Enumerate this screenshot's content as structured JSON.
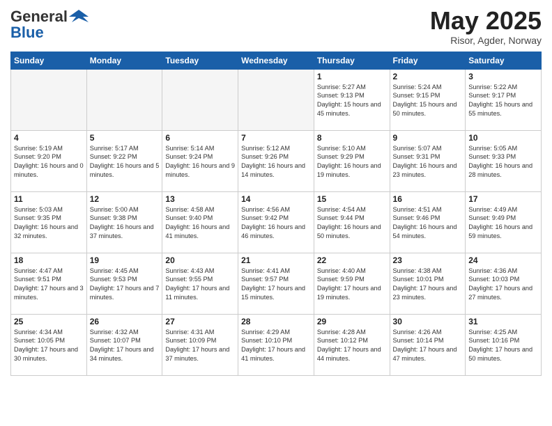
{
  "header": {
    "logo_general": "General",
    "logo_blue": "Blue",
    "month": "May 2025",
    "location": "Risor, Agder, Norway"
  },
  "days_of_week": [
    "Sunday",
    "Monday",
    "Tuesday",
    "Wednesday",
    "Thursday",
    "Friday",
    "Saturday"
  ],
  "weeks": [
    [
      {
        "day": "",
        "empty": true
      },
      {
        "day": "",
        "empty": true
      },
      {
        "day": "",
        "empty": true
      },
      {
        "day": "",
        "empty": true
      },
      {
        "day": "1",
        "sunrise": "5:27 AM",
        "sunset": "9:13 PM",
        "daylight": "15 hours and 45 minutes."
      },
      {
        "day": "2",
        "sunrise": "5:24 AM",
        "sunset": "9:15 PM",
        "daylight": "15 hours and 50 minutes."
      },
      {
        "day": "3",
        "sunrise": "5:22 AM",
        "sunset": "9:17 PM",
        "daylight": "15 hours and 55 minutes."
      }
    ],
    [
      {
        "day": "4",
        "sunrise": "5:19 AM",
        "sunset": "9:20 PM",
        "daylight": "16 hours and 0 minutes."
      },
      {
        "day": "5",
        "sunrise": "5:17 AM",
        "sunset": "9:22 PM",
        "daylight": "16 hours and 5 minutes."
      },
      {
        "day": "6",
        "sunrise": "5:14 AM",
        "sunset": "9:24 PM",
        "daylight": "16 hours and 9 minutes."
      },
      {
        "day": "7",
        "sunrise": "5:12 AM",
        "sunset": "9:26 PM",
        "daylight": "16 hours and 14 minutes."
      },
      {
        "day": "8",
        "sunrise": "5:10 AM",
        "sunset": "9:29 PM",
        "daylight": "16 hours and 19 minutes."
      },
      {
        "day": "9",
        "sunrise": "5:07 AM",
        "sunset": "9:31 PM",
        "daylight": "16 hours and 23 minutes."
      },
      {
        "day": "10",
        "sunrise": "5:05 AM",
        "sunset": "9:33 PM",
        "daylight": "16 hours and 28 minutes."
      }
    ],
    [
      {
        "day": "11",
        "sunrise": "5:03 AM",
        "sunset": "9:35 PM",
        "daylight": "16 hours and 32 minutes."
      },
      {
        "day": "12",
        "sunrise": "5:00 AM",
        "sunset": "9:38 PM",
        "daylight": "16 hours and 37 minutes."
      },
      {
        "day": "13",
        "sunrise": "4:58 AM",
        "sunset": "9:40 PM",
        "daylight": "16 hours and 41 minutes."
      },
      {
        "day": "14",
        "sunrise": "4:56 AM",
        "sunset": "9:42 PM",
        "daylight": "16 hours and 46 minutes."
      },
      {
        "day": "15",
        "sunrise": "4:54 AM",
        "sunset": "9:44 PM",
        "daylight": "16 hours and 50 minutes."
      },
      {
        "day": "16",
        "sunrise": "4:51 AM",
        "sunset": "9:46 PM",
        "daylight": "16 hours and 54 minutes."
      },
      {
        "day": "17",
        "sunrise": "4:49 AM",
        "sunset": "9:49 PM",
        "daylight": "16 hours and 59 minutes."
      }
    ],
    [
      {
        "day": "18",
        "sunrise": "4:47 AM",
        "sunset": "9:51 PM",
        "daylight": "17 hours and 3 minutes."
      },
      {
        "day": "19",
        "sunrise": "4:45 AM",
        "sunset": "9:53 PM",
        "daylight": "17 hours and 7 minutes."
      },
      {
        "day": "20",
        "sunrise": "4:43 AM",
        "sunset": "9:55 PM",
        "daylight": "17 hours and 11 minutes."
      },
      {
        "day": "21",
        "sunrise": "4:41 AM",
        "sunset": "9:57 PM",
        "daylight": "17 hours and 15 minutes."
      },
      {
        "day": "22",
        "sunrise": "4:40 AM",
        "sunset": "9:59 PM",
        "daylight": "17 hours and 19 minutes."
      },
      {
        "day": "23",
        "sunrise": "4:38 AM",
        "sunset": "10:01 PM",
        "daylight": "17 hours and 23 minutes."
      },
      {
        "day": "24",
        "sunrise": "4:36 AM",
        "sunset": "10:03 PM",
        "daylight": "17 hours and 27 minutes."
      }
    ],
    [
      {
        "day": "25",
        "sunrise": "4:34 AM",
        "sunset": "10:05 PM",
        "daylight": "17 hours and 30 minutes."
      },
      {
        "day": "26",
        "sunrise": "4:32 AM",
        "sunset": "10:07 PM",
        "daylight": "17 hours and 34 minutes."
      },
      {
        "day": "27",
        "sunrise": "4:31 AM",
        "sunset": "10:09 PM",
        "daylight": "17 hours and 37 minutes."
      },
      {
        "day": "28",
        "sunrise": "4:29 AM",
        "sunset": "10:10 PM",
        "daylight": "17 hours and 41 minutes."
      },
      {
        "day": "29",
        "sunrise": "4:28 AM",
        "sunset": "10:12 PM",
        "daylight": "17 hours and 44 minutes."
      },
      {
        "day": "30",
        "sunrise": "4:26 AM",
        "sunset": "10:14 PM",
        "daylight": "17 hours and 47 minutes."
      },
      {
        "day": "31",
        "sunrise": "4:25 AM",
        "sunset": "10:16 PM",
        "daylight": "17 hours and 50 minutes."
      }
    ]
  ]
}
